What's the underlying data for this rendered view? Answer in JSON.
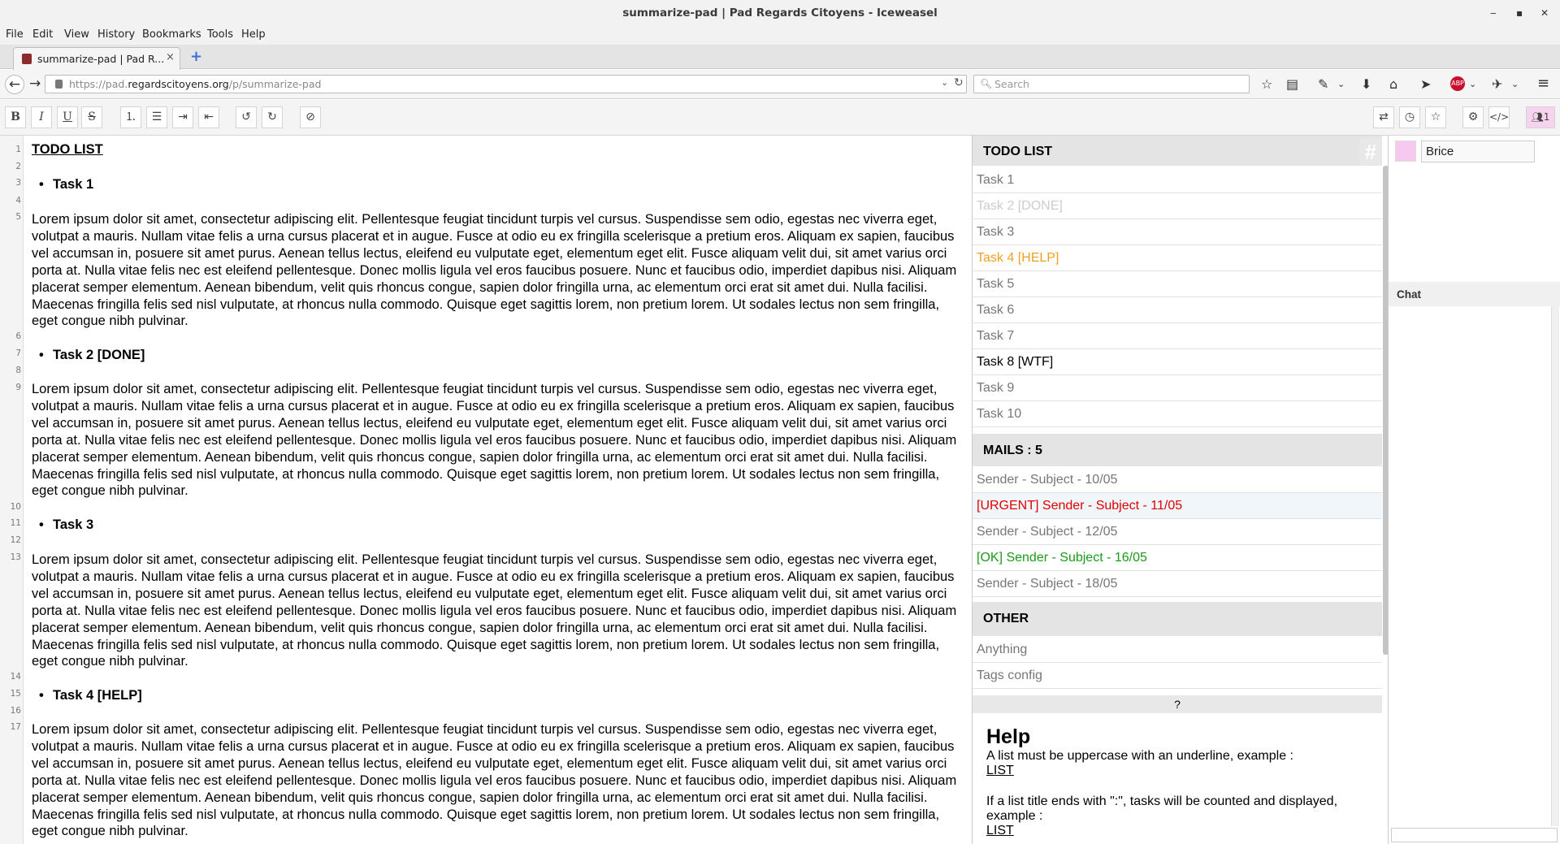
{
  "window": {
    "title": "summarize-pad | Pad Regards Citoyens - Iceweasel"
  },
  "menu": [
    "File",
    "Edit",
    "View",
    "History",
    "Bookmarks",
    "Tools",
    "Help"
  ],
  "tab": {
    "label": "summarize-pad | Pad R...",
    "close": "×",
    "newtab": "+"
  },
  "nav": {
    "url_prefix": "https://pad.",
    "url_domain": "regardscitoyens.org",
    "url_path": "/p/summarize-pad",
    "search_placeholder": "Search"
  },
  "editor": {
    "line_numbers": [
      "1",
      "2",
      "3",
      "4",
      "5",
      "6",
      "7",
      "8",
      "9",
      "10",
      "11",
      "12",
      "13",
      "14",
      "15",
      "16",
      "17"
    ],
    "title": "TODO LIST",
    "tasks": [
      "Task 1",
      "Task 2 [DONE]",
      "Task 3",
      "Task 4 [HELP]"
    ],
    "lorem": "Lorem ipsum dolor sit amet, consectetur adipiscing elit. Pellentesque feugiat tincidunt turpis vel cursus. Suspendisse sem odio, egestas nec viverra eget, volutpat a mauris. Nullam vitae felis a urna cursus placerat et in augue. Fusce at odio eu ex fringilla scelerisque a pretium eros. Aliquam ex sapien, faucibus vel accumsan in, posuere sit amet purus. Aenean tellus lectus, eleifend eu vulputate eget, elementum eget elit. Fusce aliquam velit dui, sit amet varius orci porta at. Nulla vitae felis nec est eleifend pellentesque. Donec mollis ligula vel eros faucibus posuere. Nunc et faucibus odio, imperdiet dapibus nisi. Aliquam placerat semper elementum. Aenean bibendum, velit quis rhoncus congue, sapien dolor fringilla urna, ac elementum orci erat sit amet dui. Nulla facilisi. Maecenas fringilla felis sed nisl vulputate, at rhoncus nulla commodo. Quisque eget sagittis lorem, non pretium lorem. Ut sodales lectus non sem fringilla, eget congue nibh pulvinar."
  },
  "summary": {
    "hash": "#",
    "todo_title": "TODO LIST",
    "todo_items": [
      {
        "label": "Task 1",
        "color": "#777777"
      },
      {
        "label": "Task 2 [DONE]",
        "color": "#cccccc"
      },
      {
        "label": "Task 3",
        "color": "#777777"
      },
      {
        "label": "Task 4 [HELP]",
        "color": "#f0a020"
      },
      {
        "label": "Task 5",
        "color": "#777777"
      },
      {
        "label": "Task 6",
        "color": "#777777"
      },
      {
        "label": "Task 7",
        "color": "#777777"
      },
      {
        "label": "Task 8 [WTF]",
        "color": "#000000"
      },
      {
        "label": "Task 9",
        "color": "#777777"
      },
      {
        "label": "Task 10",
        "color": "#777777"
      }
    ],
    "mails_title": "MAILS : 5",
    "mail_items": [
      {
        "label": "Sender - Subject - 10/05",
        "color": "#777777"
      },
      {
        "label": "[URGENT] Sender - Subject - 11/05",
        "color": "#e00000"
      },
      {
        "label": "Sender - Subject - 12/05",
        "color": "#777777"
      },
      {
        "label": "[OK] Sender - Subject - 16/05",
        "color": "#1a9a1a"
      },
      {
        "label": "Sender - Subject - 18/05",
        "color": "#777777"
      }
    ],
    "other_title": "OTHER",
    "other_items": [
      {
        "label": "Anything",
        "color": "#777777"
      },
      {
        "label": "Tags config",
        "color": "#777777"
      }
    ],
    "question": "?",
    "help": {
      "title": "Help",
      "line1": "A list must be uppercase with an underline, example :",
      "line2": "LIST",
      "line3": "If a list title ends with \":\", tasks will be counted and displayed,",
      "line4": "example :",
      "line5": "LIST"
    }
  },
  "users": {
    "name": "Brice",
    "color": "#f7c8f0",
    "count": "1"
  },
  "chat": {
    "title": "Chat"
  }
}
